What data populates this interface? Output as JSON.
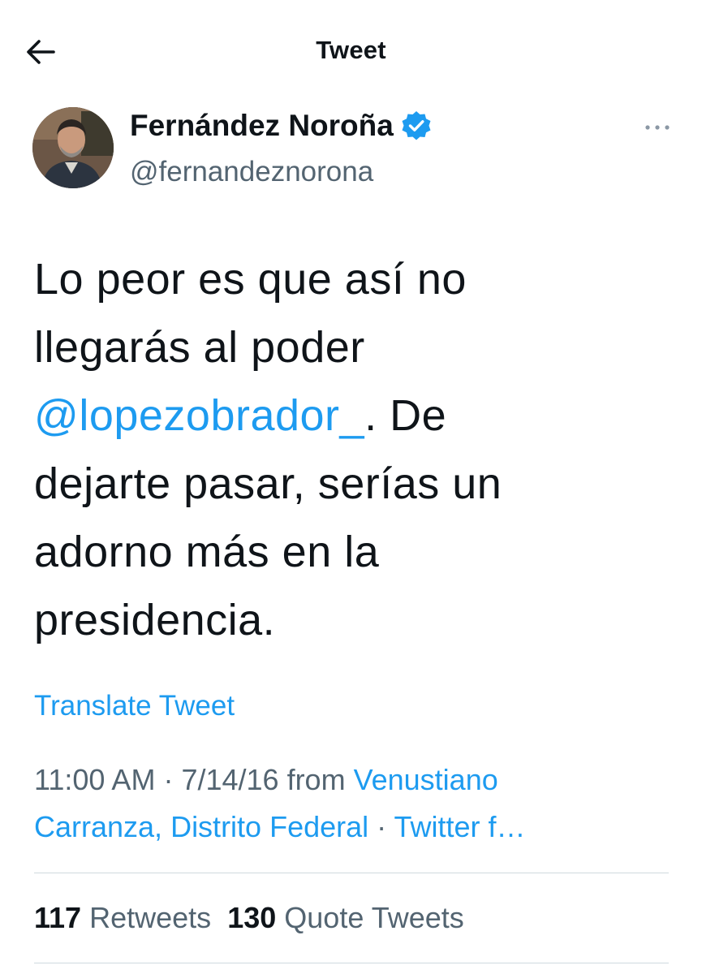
{
  "header": {
    "title": "Tweet"
  },
  "author": {
    "display_name": "Fernández Noroña",
    "handle": "@fernandeznorona",
    "verified": true
  },
  "tweet": {
    "text_line1": "Lo peor es que así no",
    "text_line2": "llegarás al poder",
    "mention": "@lopezobrador_",
    "text_after_mention": ". De",
    "text_line4": "dejarte pasar, serías un",
    "text_line5": "adorno más en la",
    "text_line6": "presidencia."
  },
  "translate_label": "Translate Tweet",
  "meta": {
    "time": "11:00 AM",
    "separator": " · ",
    "date": "7/14/16",
    "from_label": " from ",
    "location_part1": "Venustiano",
    "location_part2": "Carranza, Distrito Federal",
    "separator2": " · ",
    "source": "Twitter f…"
  },
  "stats": {
    "retweets_count": "117",
    "retweets_label": "Retweets",
    "quotes_count": "130",
    "quotes_label": "Quote Tweets"
  },
  "colors": {
    "link": "#1d9bf0",
    "secondary_text": "#536471",
    "primary_text": "#0f1419",
    "divider": "#cfd9de"
  }
}
